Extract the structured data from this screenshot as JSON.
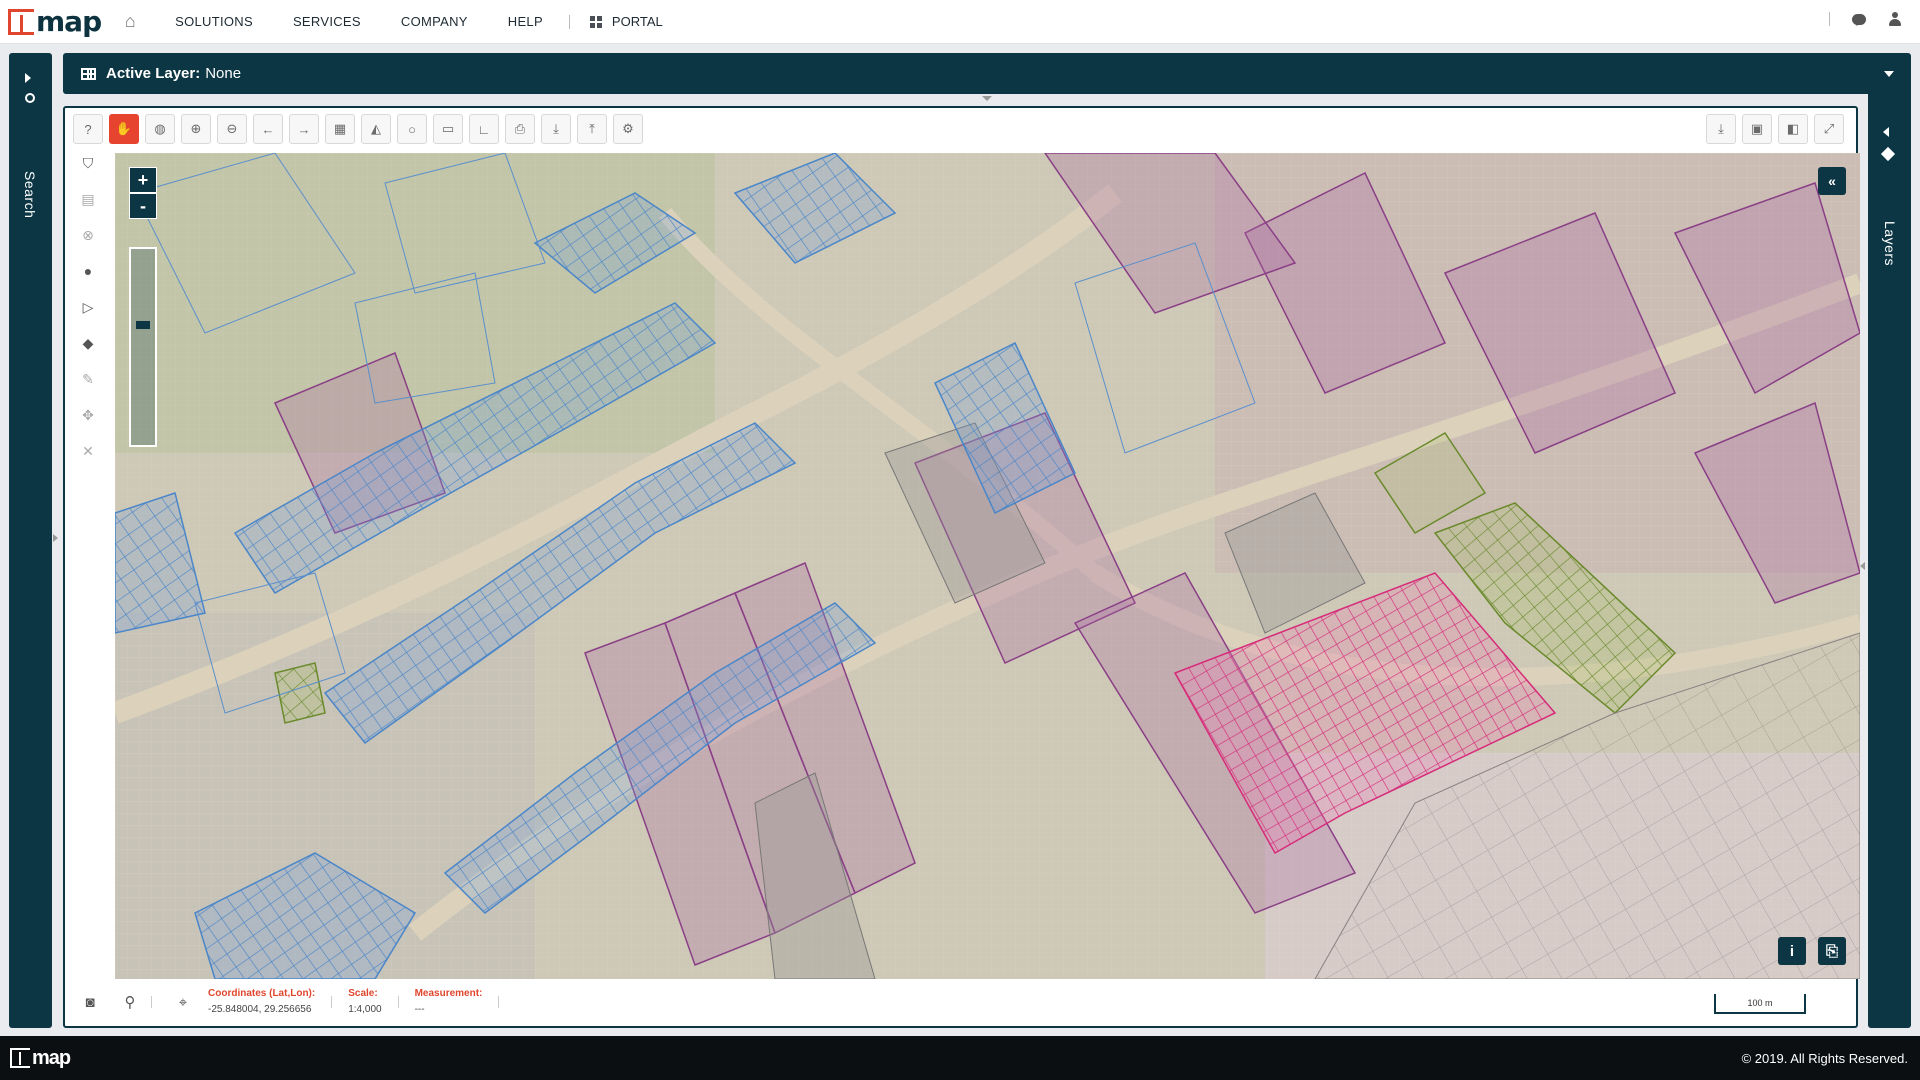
{
  "brand": {
    "logo_text": "map",
    "footer_logo_text": "map"
  },
  "nav": {
    "items": [
      {
        "label": "SOLUTIONS"
      },
      {
        "label": "SERVICES"
      },
      {
        "label": "COMPANY"
      },
      {
        "label": "HELP"
      }
    ],
    "portal_label": "PORTAL"
  },
  "side_left": {
    "label": "Search"
  },
  "side_right": {
    "label": "Layers"
  },
  "active_layer": {
    "label": "Active Layer:",
    "value": "None"
  },
  "zoom": {
    "in_label": "+",
    "out_label": "-"
  },
  "map_buttons": {
    "collapse": "«",
    "info": "i",
    "attach": "⎘"
  },
  "status": {
    "coordinates_label": "Coordinates (Lat,Lon):",
    "coordinates_value": "-25.848004, 29.256656",
    "scale_label": "Scale:",
    "scale_value": "1:4,000",
    "measurement_label": "Measurement:",
    "measurement_value": "---"
  },
  "scale_bar": {
    "label": "100 m"
  },
  "footer": {
    "copyright": "© 2019. All Rights Reserved."
  },
  "colors": {
    "brand_dark": "#0c3644",
    "accent": "#e74430",
    "parcel_blue": "#4a86c8",
    "parcel_purple": "#8a3f86",
    "parcel_pink": "#d62c7a",
    "parcel_green": "#6a8a2c"
  },
  "icons": {
    "toolbar": [
      "help-icon",
      "pan-hand-icon",
      "globe-icon",
      "zoom-in-icon",
      "zoom-out-icon",
      "back-arrow-icon",
      "forward-arrow-icon",
      "table-icon",
      "chart-icon",
      "circle-icon",
      "ruler-icon",
      "corner-icon",
      "print-icon",
      "download-icon",
      "upload-icon",
      "settings-icon"
    ],
    "toolbar_right": [
      "export-icon",
      "image-icon",
      "split-view-icon",
      "fullscreen-icon"
    ],
    "left_tools": [
      "binoculars-icon",
      "map-icon",
      "clear-icon",
      "draw-circle-icon",
      "draw-line-icon",
      "draw-polygon-icon",
      "edit-pencil-icon",
      "move-icon",
      "delete-icon"
    ]
  }
}
